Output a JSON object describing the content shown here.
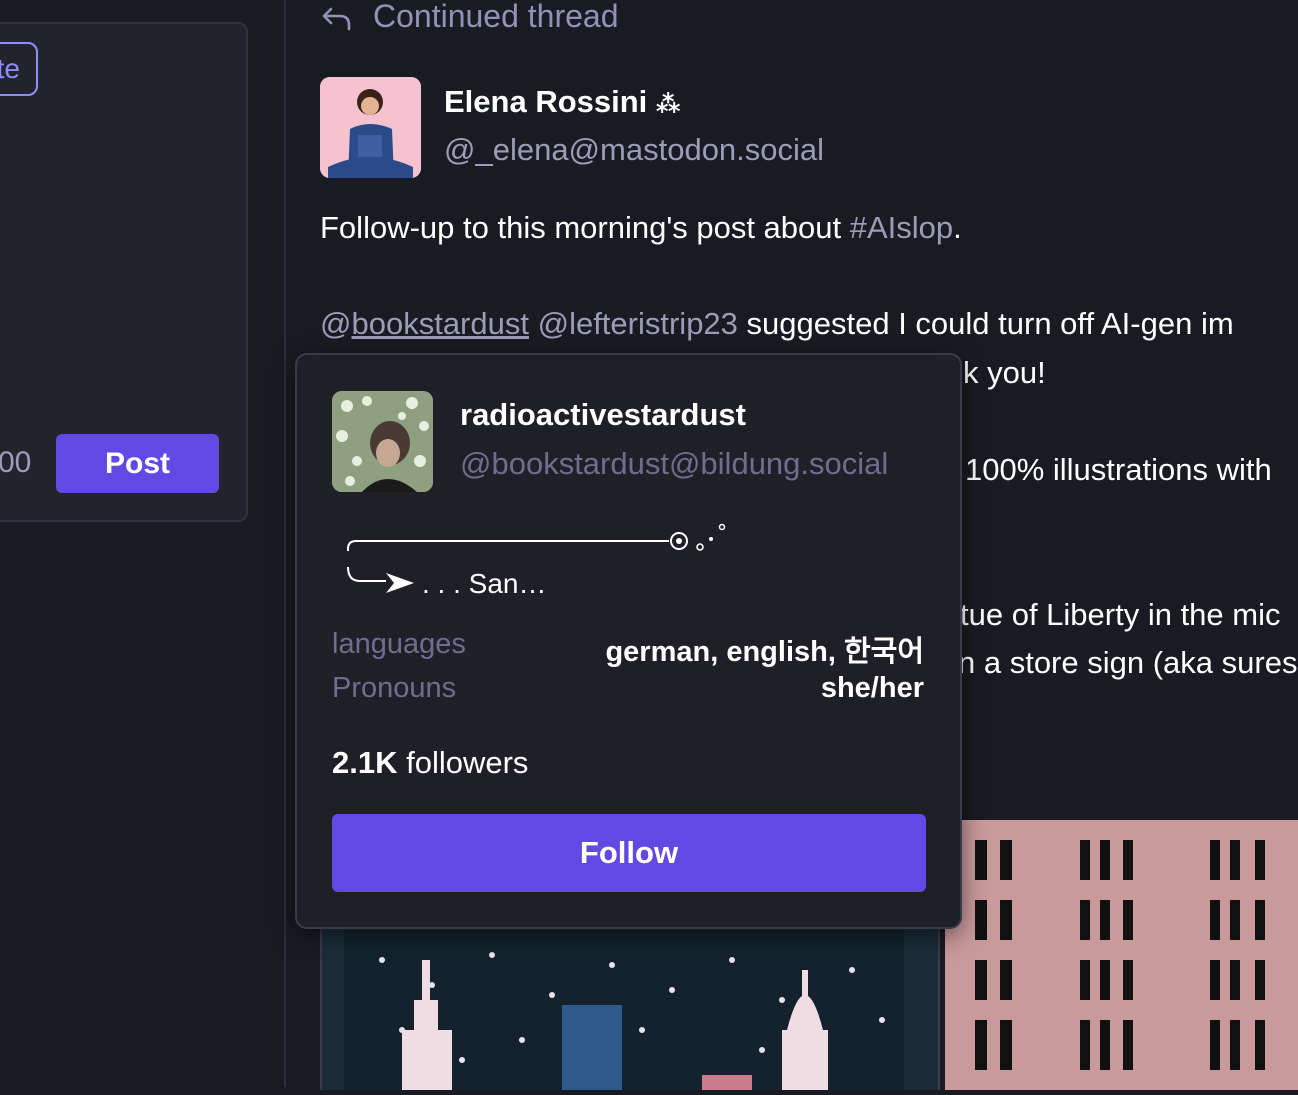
{
  "compose": {
    "chip_text": "te",
    "char_count": "00",
    "post_label": "Post"
  },
  "thread": {
    "header_label": "Continued thread"
  },
  "post": {
    "author_name": "Elena Rossini",
    "author_badge": "⁂",
    "author_handle": "@_elena@mastodon.social",
    "line1_text": "Follow-up to this morning's post about ",
    "line1_hashtag": "#AIslop",
    "line1_end": ".",
    "line2_at": "@",
    "line2_mention": "bookstardust",
    "line2_mention2": " @lefteristrip23",
    "line2_rest": " suggested I could turn off AI-gen im",
    "line3": "k you!",
    "line4": "100% illustrations with",
    "line5": "tue of Liberty in the mic",
    "line6": "n a store sign (aka sures"
  },
  "profile_card": {
    "display_name": "radioactivestardust",
    "handle": "@bookstardust@bildung.social",
    "bio": ". . . San…",
    "fields": [
      {
        "label": "languages",
        "value": "german, english, 한국어"
      },
      {
        "label": "Pronouns",
        "value": "she/her"
      }
    ],
    "followers_count": "2.1K",
    "followers_label": " followers",
    "follow_label": "Follow"
  },
  "colors": {
    "background": "#191b22",
    "accent": "#6249e3",
    "muted_text": "#9a9db7",
    "popover_bg": "#1f1f28"
  }
}
